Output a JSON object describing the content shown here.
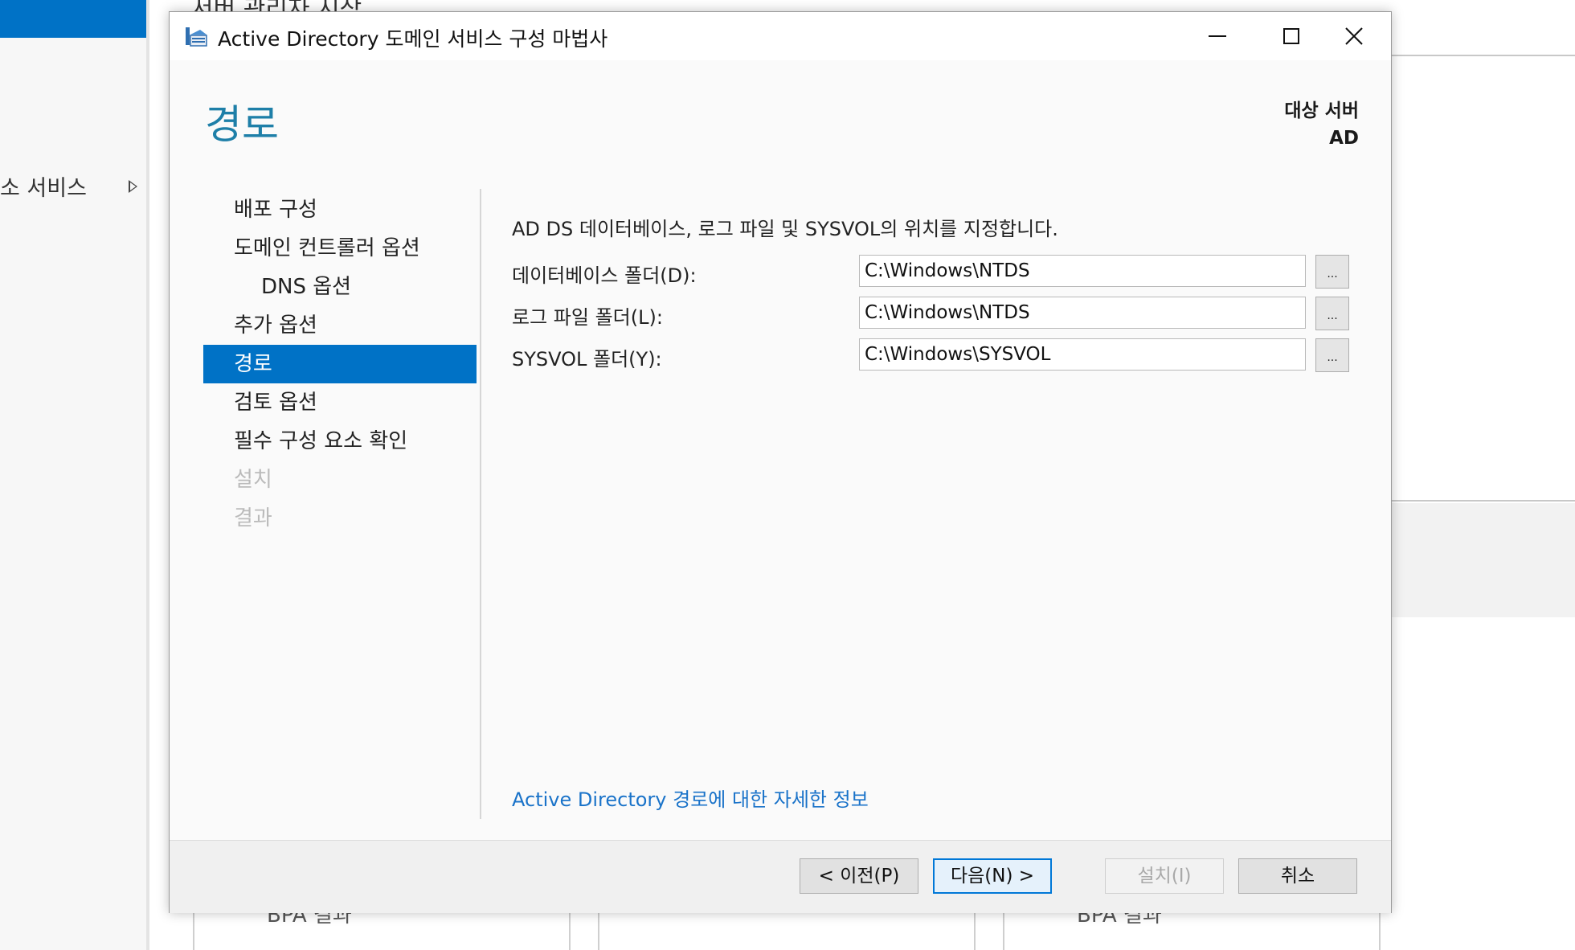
{
  "background": {
    "header_title": "서버 관리자 시작",
    "nav_item": "소 서비스",
    "tile_labels": [
      "BPA 결과",
      "BPA 결과"
    ]
  },
  "dialog": {
    "title": "Active Directory 도메인 서비스 구성 마법사",
    "window_controls": {
      "minimize": "minimize-icon",
      "maximize": "maximize-icon",
      "close": "close-icon"
    },
    "heading": "경로",
    "target_server": {
      "label": "대상 서버",
      "value": "AD"
    },
    "steps": [
      {
        "label": "배포 구성",
        "state": "normal",
        "indent": false
      },
      {
        "label": "도메인 컨트롤러 옵션",
        "state": "normal",
        "indent": false
      },
      {
        "label": "DNS 옵션",
        "state": "normal",
        "indent": true
      },
      {
        "label": "추가 옵션",
        "state": "normal",
        "indent": false
      },
      {
        "label": "경로",
        "state": "active",
        "indent": false
      },
      {
        "label": "검토 옵션",
        "state": "normal",
        "indent": false
      },
      {
        "label": "필수 구성 요소 확인",
        "state": "normal",
        "indent": false
      },
      {
        "label": "설치",
        "state": "disabled",
        "indent": false
      },
      {
        "label": "결과",
        "state": "disabled",
        "indent": false
      }
    ],
    "description": "AD DS 데이터베이스, 로그 파일 및 SYSVOL의 위치를 지정합니다.",
    "fields": [
      {
        "label": "데이터베이스 폴더(D):",
        "value": "C:\\Windows\\NTDS",
        "browse": "..."
      },
      {
        "label": "로그 파일 폴더(L):",
        "value": "C:\\Windows\\NTDS",
        "browse": "..."
      },
      {
        "label": "SYSVOL 폴더(Y):",
        "value": "C:\\Windows\\SYSVOL",
        "browse": "..."
      }
    ],
    "more_info_link": "Active Directory 경로에 대한 자세한 정보",
    "buttons": {
      "previous": "< 이전(P)",
      "next": "다음(N) >",
      "install": "설치(I)",
      "cancel": "취소"
    }
  },
  "colors": {
    "accent": "#0072c6",
    "heading": "#1e7fa8",
    "link": "#1a73c9",
    "disabled_text": "#bbbbbb"
  }
}
